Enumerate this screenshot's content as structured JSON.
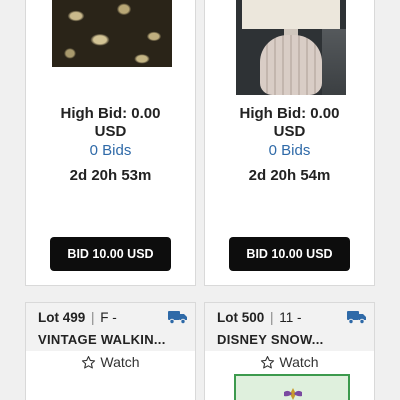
{
  "cards": [
    {
      "high_bid": "High Bid: 0.00",
      "currency": "USD",
      "bids": "0 Bids",
      "time_left": "2d 20h 53m",
      "bid_button": "BID 10.00 USD"
    },
    {
      "high_bid": "High Bid: 0.00",
      "currency": "USD",
      "bids": "0 Bids",
      "time_left": "2d 20h 54m",
      "bid_button": "BID 10.00 USD"
    }
  ],
  "lots": [
    {
      "lot_label": "Lot 499",
      "category": "F -",
      "title": "VINTAGE WALKIN...",
      "watch": "Watch"
    },
    {
      "lot_label": "Lot 500",
      "category": "11 -",
      "title": "DISNEY SNOW...",
      "watch": "Watch"
    }
  ],
  "colors": {
    "accent_blue": "#2f6aa8",
    "button_bg": "#0d0d0d",
    "truck_icon": "#2f6aa8"
  },
  "icons": {
    "shipping": "truck-icon",
    "watch": "star-outline-icon"
  }
}
